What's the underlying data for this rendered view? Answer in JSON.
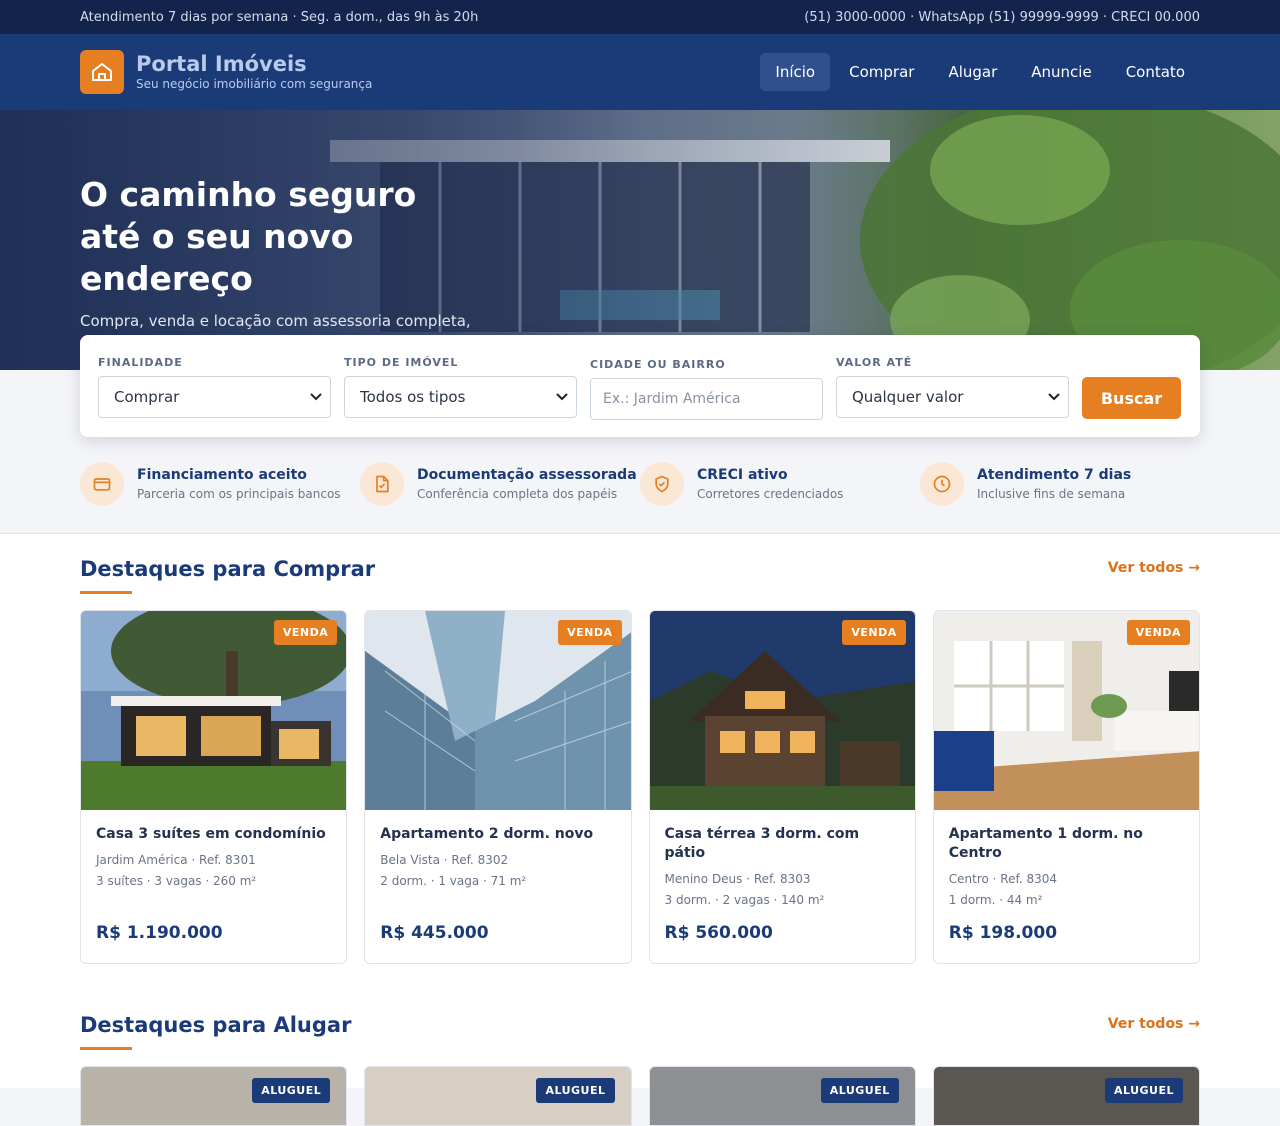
{
  "topbar": {
    "left": "Atendimento 7 dias por semana · Seg. a dom., das 9h às 20h",
    "right": "(51) 3000-0000 · WhatsApp (51) 99999-9999 · CRECI 00.000"
  },
  "brand": {
    "title": "Portal Imóveis",
    "subtitle": "Seu negócio imobiliário com segurança"
  },
  "nav": [
    {
      "label": "Início",
      "active": true
    },
    {
      "label": "Comprar"
    },
    {
      "label": "Alugar"
    },
    {
      "label": "Anuncie"
    },
    {
      "label": "Contato"
    }
  ],
  "hero": {
    "title": "O caminho seguro até o seu novo endereço",
    "subtitle": "Compra, venda e locação com assessoria completa, do primeiro contato à entrega das chaves."
  },
  "search": {
    "finalidade_label": "FINALIDADE",
    "finalidade_value": "Comprar",
    "tipo_label": "TIPO DE IMÓVEL",
    "tipo_value": "Todos os tipos",
    "cidade_label": "CIDADE OU BAIRRO",
    "cidade_placeholder": "Ex.: Jardim América",
    "valor_label": "VALOR ATÉ",
    "valor_value": "Qualquer valor",
    "button": "Buscar"
  },
  "features": [
    {
      "icon": "card-icon",
      "title": "Financiamento aceito",
      "subtitle": "Parceria com os principais bancos"
    },
    {
      "icon": "document-icon",
      "title": "Documentação assessorada",
      "subtitle": "Conferência completa dos papéis"
    },
    {
      "icon": "shield-icon",
      "title": "CRECI ativo",
      "subtitle": "Corretores credenciados"
    },
    {
      "icon": "clock-icon",
      "title": "Atendimento 7 dias",
      "subtitle": "Inclusive fins de semana"
    }
  ],
  "buy_section": {
    "title": "Destaques para Comprar",
    "link": "Ver todos →",
    "badge": "VENDA",
    "cards": [
      {
        "title": "Casa 3 suítes em condomínio",
        "location": "Jardim América · Ref. 8301",
        "specs": "3 suítes · 3 vagas · 260 m²",
        "price": "R$ 1.190.000"
      },
      {
        "title": "Apartamento 2 dorm. novo",
        "location": "Bela Vista · Ref. 8302",
        "specs": "2 dorm. · 1 vaga · 71 m²",
        "price": "R$ 445.000"
      },
      {
        "title": "Casa térrea 3 dorm. com pátio",
        "location": "Menino Deus · Ref. 8303",
        "specs": "3 dorm. · 2 vagas · 140 m²",
        "price": "R$ 560.000"
      },
      {
        "title": "Apartamento 1 dorm. no Centro",
        "location": "Centro · Ref. 8304",
        "specs": "1 dorm. · 44 m²",
        "price": "R$ 198.000"
      }
    ]
  },
  "rent_section": {
    "title": "Destaques para Alugar",
    "link": "Ver todos →",
    "badge": "ALUGUEL"
  },
  "colors": {
    "navy": "#1b3a78",
    "orange": "#e67e22",
    "topbar": "#12244c"
  }
}
